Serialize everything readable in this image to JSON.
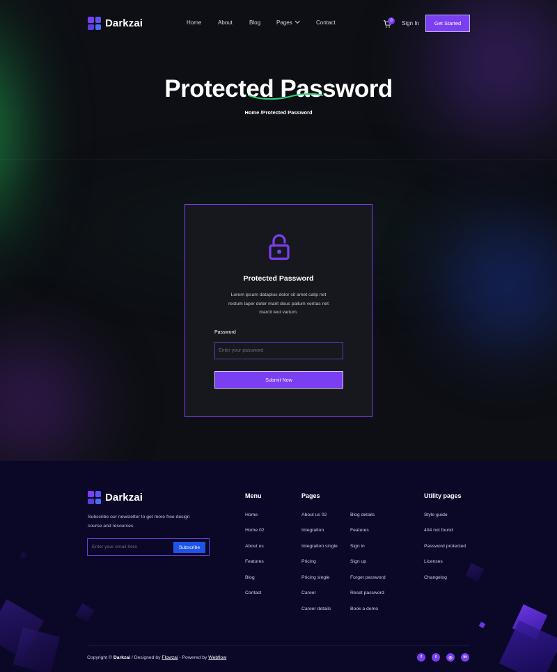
{
  "brand": {
    "name": "Darkzai"
  },
  "nav": {
    "links": [
      {
        "label": "Home"
      },
      {
        "label": "About"
      },
      {
        "label": "Blog"
      },
      {
        "label": "Pages"
      },
      {
        "label": "Contact"
      }
    ],
    "cart_count": "0",
    "signin_label": "Sign In",
    "cta_label": "Get Started"
  },
  "hero": {
    "title": "Protected Password",
    "breadcrumb": "Home /Protected Password"
  },
  "card": {
    "title": "Protected Password",
    "text": "Lorem ipsum dataplus dolor sit amet calip net restum laper doter marit deus pallum veritas net marcit leut varium.",
    "password_label": "Password",
    "password_placeholder": "Enter your password",
    "submit_label": "Submit Now"
  },
  "footer": {
    "description": "Subscribe our newsletter to get more free design course and resources.",
    "newsletter_placeholder": "Enter your email here",
    "subscribe_label": "Subscribe",
    "menu": {
      "title": "Menu",
      "links": [
        "Home",
        "Home 02",
        "About us",
        "Features",
        "Blog",
        "Contact"
      ]
    },
    "pages": {
      "title": "Pages",
      "col1": [
        "About us 02",
        "Integration",
        "Integration single",
        "Pricing",
        "Pricing single",
        "Career",
        "Career details"
      ],
      "col2": [
        "Blog details",
        "Features",
        "Sign in",
        "Sign up",
        "Forget password",
        "Reset password",
        "Book a demo"
      ]
    },
    "utility": {
      "title": "Utility pages",
      "links": [
        "Style guide",
        "404 not found",
        "Password protected",
        "Licenses",
        "Changelog"
      ]
    },
    "copyright": {
      "prefix": "Copyright ©",
      "brand": "Darkzai",
      "designed": "/ Designed by",
      "designer": "Flowzai",
      "powered": "- Powered by",
      "platform": "Webflow"
    },
    "social": [
      {
        "icon": "facebook-icon",
        "glyph": "f"
      },
      {
        "icon": "twitter-icon",
        "glyph": "t"
      },
      {
        "icon": "instagram-icon",
        "glyph": "◎"
      },
      {
        "icon": "linkedin-icon",
        "glyph": "in"
      }
    ]
  },
  "colors": {
    "accent": "#7b3ff2",
    "subscribe_blue": "#1e55e6",
    "footer_bg": "#0b0727",
    "underline_green": "#2ed47a"
  }
}
